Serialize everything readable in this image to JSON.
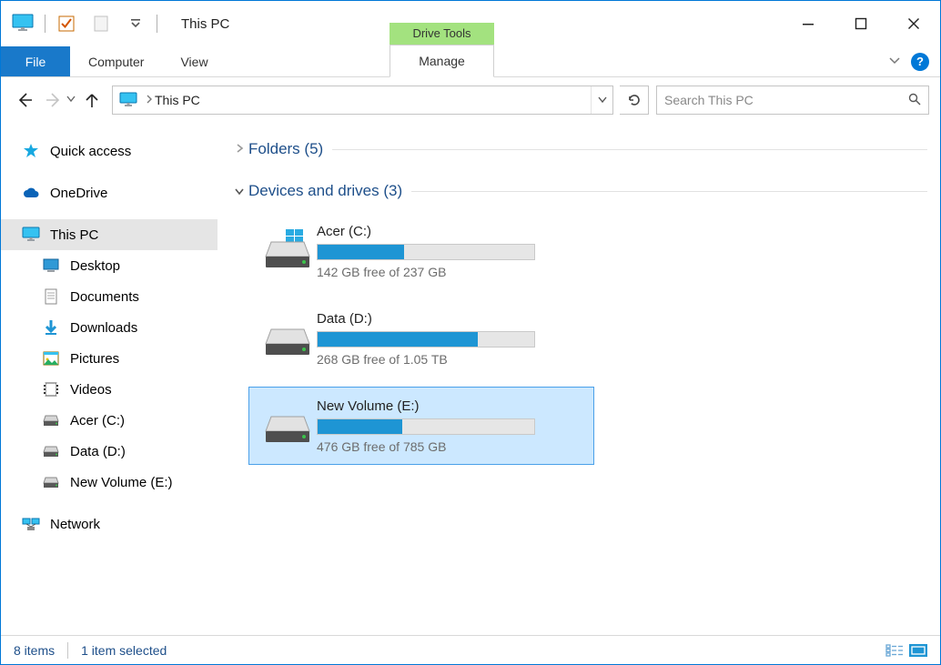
{
  "window_title": "This PC",
  "ribbon": {
    "file": "File",
    "tabs": [
      "Computer",
      "View"
    ],
    "contextual_group": "Drive Tools",
    "contextual_tab": "Manage"
  },
  "address": {
    "location": "This PC",
    "refresh_icon": "refresh"
  },
  "search": {
    "placeholder": "Search This PC"
  },
  "sidebar": {
    "items": [
      {
        "label": "Quick access",
        "icon": "star",
        "level": 0
      },
      {
        "gap": true
      },
      {
        "label": "OneDrive",
        "icon": "cloud",
        "level": 0
      },
      {
        "gap": true
      },
      {
        "label": "This PC",
        "icon": "monitor",
        "level": 0,
        "selected": true
      },
      {
        "label": "Desktop",
        "icon": "desktop",
        "level": 1
      },
      {
        "label": "Documents",
        "icon": "document",
        "level": 1
      },
      {
        "label": "Downloads",
        "icon": "download",
        "level": 1
      },
      {
        "label": "Pictures",
        "icon": "image",
        "level": 1
      },
      {
        "label": "Videos",
        "icon": "film",
        "level": 1
      },
      {
        "label": "Acer (C:)",
        "icon": "drive",
        "level": 1
      },
      {
        "label": "Data (D:)",
        "icon": "drive",
        "level": 1
      },
      {
        "label": "New Volume (E:)",
        "icon": "drive",
        "level": 1
      },
      {
        "gap": true
      },
      {
        "label": "Network",
        "icon": "network",
        "level": 0
      }
    ]
  },
  "sections": {
    "folders": {
      "label": "Folders",
      "count": 5,
      "expanded": false
    },
    "drives": {
      "label": "Devices and drives",
      "count": 3,
      "expanded": true
    }
  },
  "drives": [
    {
      "name": "Acer (C:)",
      "free_text": "142 GB free of 237 GB",
      "fill_pct": 40,
      "has_windows_logo": true
    },
    {
      "name": "Data (D:)",
      "free_text": "268 GB free of 1.05 TB",
      "fill_pct": 74,
      "has_windows_logo": false
    },
    {
      "name": "New Volume (E:)",
      "free_text": "476 GB free of 785 GB",
      "fill_pct": 39,
      "has_windows_logo": false,
      "selected": true
    }
  ],
  "status": {
    "count_label": "8 items",
    "selection_label": "1 item selected"
  }
}
